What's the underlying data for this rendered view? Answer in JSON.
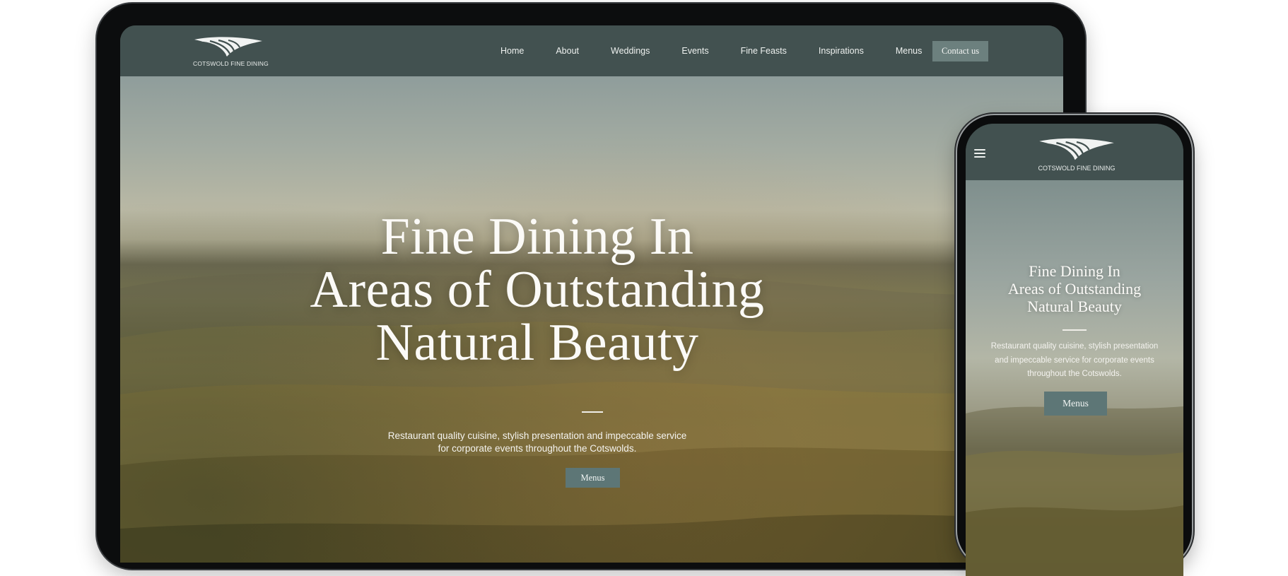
{
  "desktop": {
    "logo": {
      "icon": "cotswold-wing-logo",
      "text": "COTSWOLD FINE DINING"
    },
    "nav": {
      "items": [
        {
          "label": "Home",
          "active": true
        },
        {
          "label": "About"
        },
        {
          "label": "Weddings"
        },
        {
          "label": "Events"
        },
        {
          "label": "Fine Feasts"
        },
        {
          "label": "Inspirations"
        },
        {
          "label": "Menus"
        }
      ],
      "contact_label": "Contact us"
    },
    "hero": {
      "headline_lines": [
        "Fine Dining In",
        "Areas of Outstanding",
        "Natural Beauty"
      ],
      "subtitle_lines": [
        "Restaurant quality cuisine, stylish presentation and impeccable service",
        "for corporate events throughout the Cotswolds."
      ],
      "cta_label": "Menus"
    }
  },
  "mobile": {
    "logo": {
      "icon": "cotswold-wing-logo",
      "text": "COTSWOLD FINE DINING"
    },
    "menu_icon": "hamburger-menu-icon",
    "hero": {
      "headline_lines": [
        "Fine Dining In",
        "Areas of Outstanding",
        "Natural Beauty"
      ],
      "subtitle_lines": [
        "Restaurant quality cuisine, stylish presentation",
        "and impeccable service for corporate events",
        "throughout the Cotswolds."
      ],
      "cta_label": "Menus"
    }
  },
  "colors": {
    "nav_bg": "#425150",
    "button_bg": "#5d7676",
    "contact_bg": "#6c807e",
    "text_light": "#fbfaf7"
  }
}
